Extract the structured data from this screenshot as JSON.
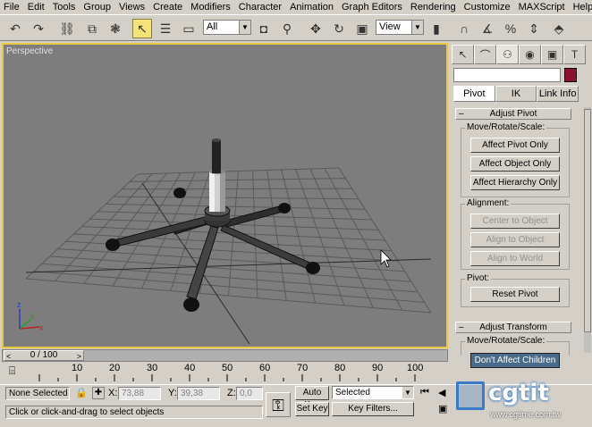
{
  "menubar": {
    "items": [
      "File",
      "Edit",
      "Tools",
      "Group",
      "Views",
      "Create",
      "Modifiers",
      "Character",
      "Animation",
      "Graph Editors",
      "Rendering",
      "Customize",
      "MAXScript",
      "Help"
    ]
  },
  "toolbar": {
    "selection_filter": "All",
    "ref_coord": "View"
  },
  "viewport": {
    "label": "Perspective"
  },
  "command_panel": {
    "sub_tabs": [
      "Pivot",
      "IK",
      "Link Info"
    ],
    "active_sub_tab": "Pivot",
    "adjust_pivot": {
      "title": "Adjust Pivot",
      "move_rotate_scale_label": "Move/Rotate/Scale:",
      "btn_pivot_only": "Affect Pivot Only",
      "btn_object_only": "Affect Object Only",
      "btn_hierarchy_only": "Affect Hierarchy Only",
      "alignment_label": "Alignment:",
      "btn_center": "Center to Object",
      "btn_align_object": "Align to Object",
      "btn_align_world": "Align to World",
      "pivot_label": "Pivot:",
      "btn_reset": "Reset Pivot"
    },
    "adjust_transform": {
      "title": "Adjust Transform",
      "move_rotate_scale_label": "Move/Rotate/Scale:",
      "btn_dont_affect": "Don't Affect Children"
    }
  },
  "time_slider": {
    "label": "0 / 100"
  },
  "trackbar": {
    "ticks": [
      "10",
      "20",
      "30",
      "40",
      "50",
      "60",
      "70",
      "80",
      "90",
      "100"
    ]
  },
  "status": {
    "selection": "None Selected",
    "prompt": "Click or click-and-drag to select objects",
    "x_label": "X:",
    "x_value": "73,88",
    "y_label": "Y:",
    "y_value": "39,38",
    "z_label": "Z:",
    "z_value": "0,0",
    "auto_key": "Auto Key",
    "set_key": "Set Key",
    "key_mode": "Selected",
    "key_filters": "Key Filters..."
  },
  "watermark": {
    "text": "cgtit",
    "url": "www.cgtime.com.tw"
  }
}
